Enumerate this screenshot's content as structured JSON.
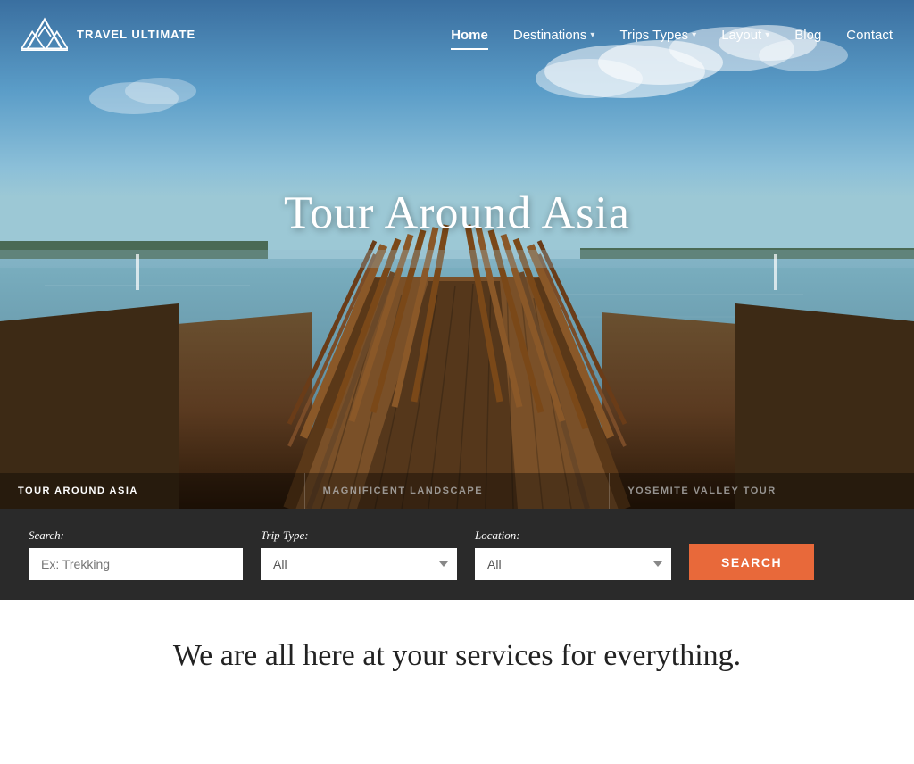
{
  "brand": {
    "name": "TRAVEL ULTIMATE"
  },
  "nav": {
    "items": [
      {
        "label": "Home",
        "active": true,
        "hasDropdown": false
      },
      {
        "label": "Destinations",
        "active": false,
        "hasDropdown": true
      },
      {
        "label": "Trips Types",
        "active": false,
        "hasDropdown": true
      },
      {
        "label": "Layout",
        "active": false,
        "hasDropdown": true
      },
      {
        "label": "Blog",
        "active": false,
        "hasDropdown": false
      },
      {
        "label": "Contact",
        "active": false,
        "hasDropdown": false
      }
    ]
  },
  "hero": {
    "title": "Tour Around Asia",
    "slides": [
      {
        "label": "Tour Around Asia",
        "active": true
      },
      {
        "label": "Magnificent Landscape",
        "active": false
      },
      {
        "label": "Yosemite Valley Tour",
        "active": false
      }
    ]
  },
  "search": {
    "label_search": "Search:",
    "label_trip_type": "Trip Type:",
    "label_location": "Location:",
    "search_placeholder": "Ex: Trekking",
    "trip_type_default": "All",
    "location_default": "All",
    "button_label": "SEARCH"
  },
  "tagline": {
    "text": "We are all here at your services for everything."
  }
}
